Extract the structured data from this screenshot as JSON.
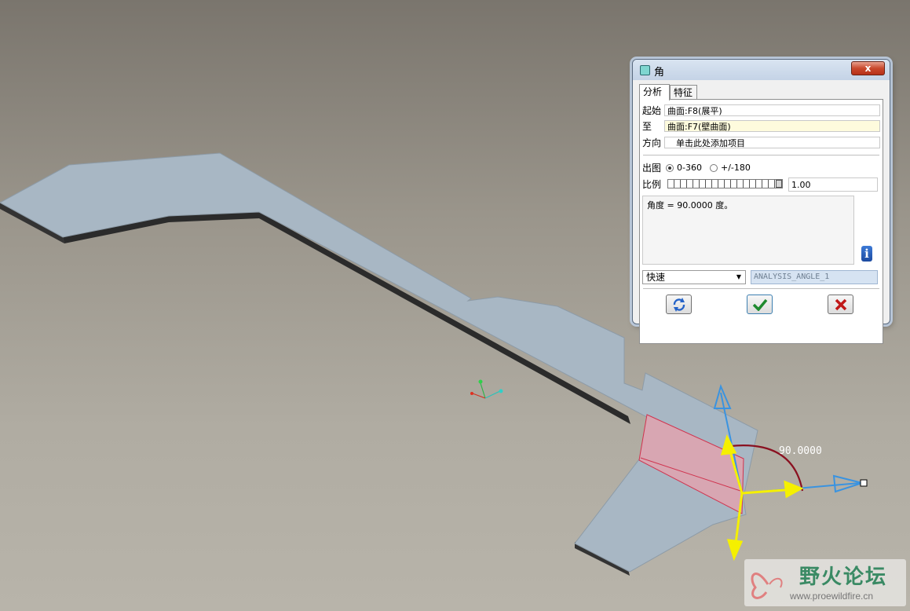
{
  "dialog": {
    "title": "角",
    "close_label": "x",
    "tabs": [
      "分析",
      "特征"
    ],
    "from": {
      "label": "起始",
      "value": "曲面:F8(展平)"
    },
    "to": {
      "label": "至",
      "value": "曲面:F7(壁曲面)"
    },
    "direction": {
      "label": "方向",
      "value": "单击此处添加项目"
    },
    "output": {
      "label": "出图",
      "options": [
        "0-360",
        "+/-180"
      ],
      "selected": "0-360"
    },
    "scale": {
      "label": "比例",
      "value": "1.00"
    },
    "result_text": "角度 = 90.0000 度。",
    "mode_select": "快速",
    "analysis_name": "ANALYSIS_ANGLE_1"
  },
  "viewport": {
    "angle_annotation": "90.0000"
  },
  "watermark": {
    "title": "野火论坛",
    "url": "www.proewildfire.cn"
  },
  "colors": {
    "part_top": "#a8b7c4",
    "part_edge": "#2e2e2e",
    "highlight_surface": "#d7a3b0",
    "arrow_yellow": "#f5f000",
    "arrow_blue": "#3a93e0",
    "arc": "#8a1020"
  }
}
